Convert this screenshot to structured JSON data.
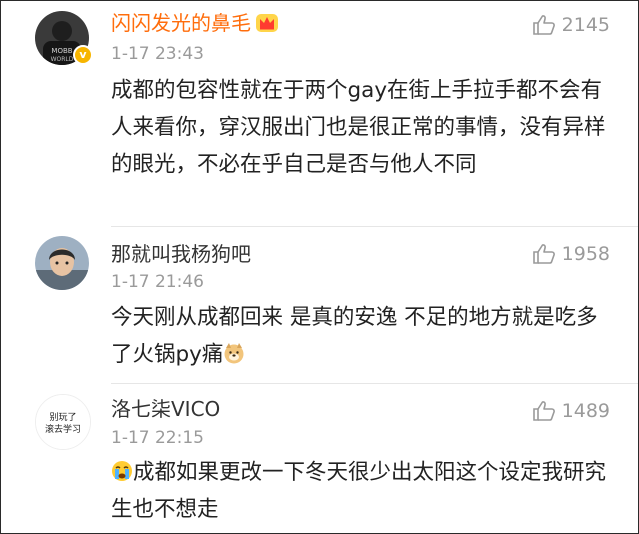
{
  "comments": [
    {
      "username": "闪闪发光的鼻毛",
      "time": "1-17 23:43",
      "likes": "2145",
      "verified": true,
      "vip_badge": "crown-icon",
      "avatar": "avatar-dark-person",
      "text": "成都的包容性就在于两个gay在街上手拉手都不会有人来看你，穿汉服出门也是很正常的事情，没有异样的眼光，不必在乎自己是否与他人不同"
    },
    {
      "username": "那就叫我杨狗吧",
      "time": "1-17 21:46",
      "likes": "1958",
      "avatar": "avatar-person-photo",
      "text": "今天刚从成都回来 是真的安逸  不足的地方就是吃多了火锅py痛",
      "emoji": "doge-emoji-icon"
    },
    {
      "username": "洛七柒VICO",
      "time": "1-17 22:15",
      "likes": "1489",
      "avatar": "avatar-text",
      "avatar_text": [
        "别玩了",
        "滚去学习"
      ],
      "emoji": "crying-emoji-icon",
      "text": "成都如果更改一下冬天很少出太阳这个设定我研究生也不想走"
    }
  ],
  "colors": {
    "vip_name": "#ff6d0c",
    "name": "#333333",
    "meta": "#9a9a9a",
    "text": "#222222",
    "verified_badge": "#f7b500",
    "divider": "#e6e6e6"
  }
}
